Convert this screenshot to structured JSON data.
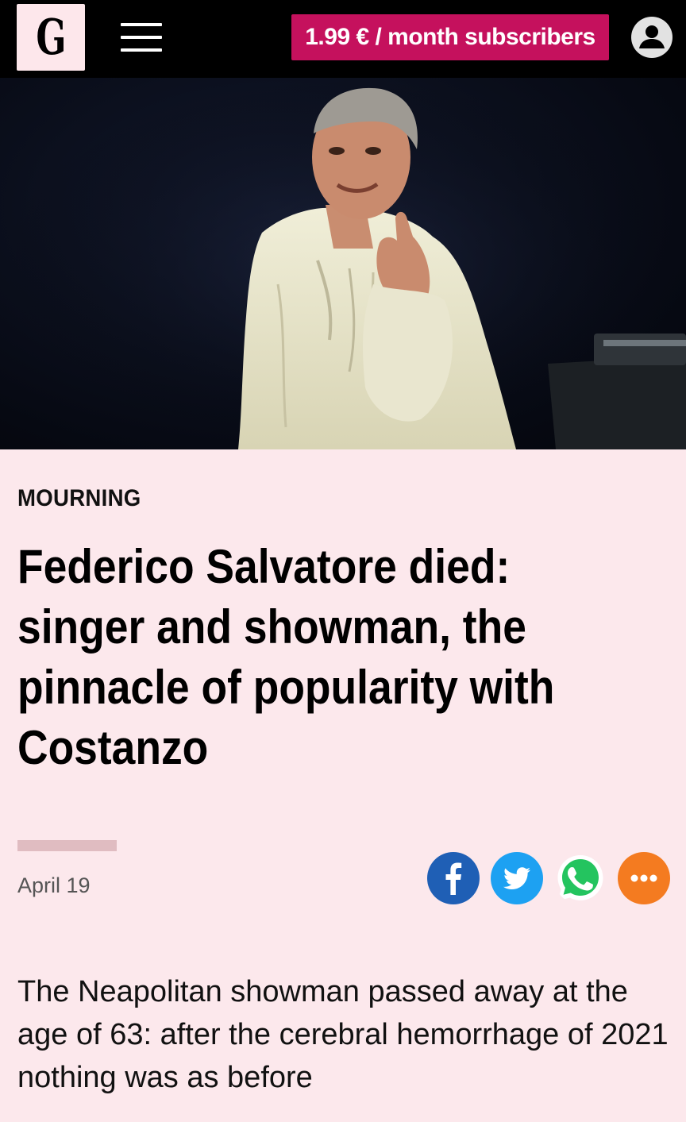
{
  "header": {
    "logo_letter": "G",
    "subscribe_label": "1.99 € / month subscribers"
  },
  "hero_image": {
    "alt": "Federico Salvatore on stage in a white shirt, raising his index finger"
  },
  "article": {
    "category": "MOURNING",
    "headline": "Federico Salvatore died: singer and showman, the pinnacle of popularity with Costanzo",
    "date": "April 19",
    "summary": "The Neapolitan showman passed away at the age of 63: after the cerebral hemorrhage of 2021 nothing was as before"
  },
  "share_buttons": [
    {
      "icon": "facebook-icon",
      "color": "#1f5fb5"
    },
    {
      "icon": "twitter-icon",
      "color": "#1da1f2"
    },
    {
      "icon": "whatsapp-icon",
      "color": "#23c45e"
    },
    {
      "icon": "more-icon",
      "color": "#f47b20"
    }
  ],
  "colors": {
    "accent": "#c5115d",
    "background": "#fce8ec",
    "topbar": "#000000"
  }
}
